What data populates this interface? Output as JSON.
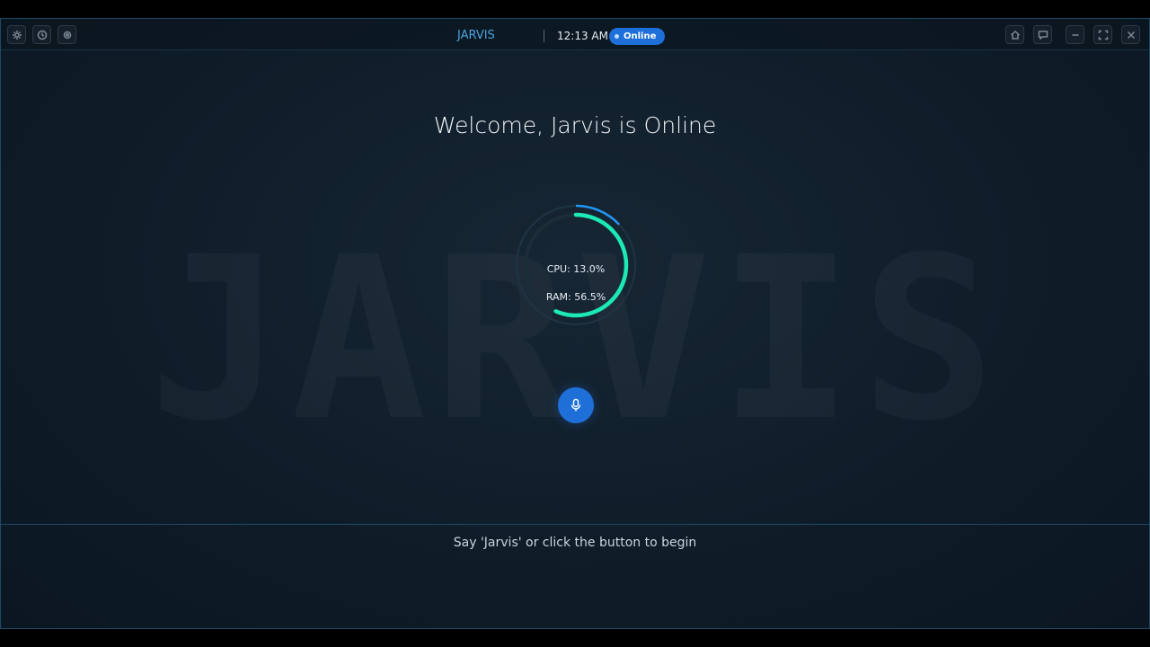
{
  "window": {
    "app_title": "JARVIS",
    "time": "12:13 AM",
    "status": "Online",
    "left_controls": [
      "settings-icon",
      "history-icon",
      "camera-icon"
    ],
    "right_controls": [
      "home-icon",
      "chat-icon",
      "minimize-icon",
      "maximize-icon",
      "close-icon"
    ]
  },
  "main": {
    "watermark": "JARVIS",
    "welcome": "Welcome, Jarvis is Online",
    "cpu_label": "CPU: 13.0%",
    "ram_label": "RAM: 56.5%",
    "cpu_percent": 13.0,
    "ram_percent": 56.5,
    "mic_icon": "microphone-icon"
  },
  "footer": {
    "hint": "Say 'Jarvis' or click the button to begin"
  },
  "colors": {
    "accent_blue": "#1f6fd8",
    "ram_ring": "#1de9b6",
    "cpu_ring": "#2196f3",
    "title_blue": "#4aa3e0"
  }
}
